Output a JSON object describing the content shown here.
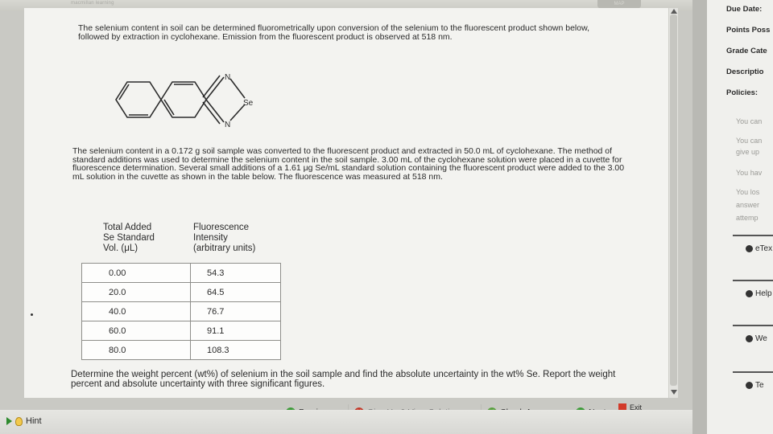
{
  "header": {
    "brand": "macmillan learning",
    "map_label": "MAP"
  },
  "question": {
    "intro": "The selenium content in soil can be determined fluorometrically upon conversion of the selenium to the fluorescent product shown below, followed by extraction in cyclohexane. Emission from the fluorescent product is observed at 518 nm.",
    "molecule_labels": {
      "n_top": "N",
      "se": "Se",
      "n_bottom": "N"
    },
    "body": "The selenium content in a 0.172 g soil sample was converted to the fluorescent product and extracted in 50.0 mL of cyclohexane. The method of standard additions was used to determine the selenium content in the soil sample. 3.00 mL of the cyclohexane solution were placed in a cuvette for fluorescence determination. Several small additions of a 1.61 μg Se/mL standard solution containing the fluorescent product were added to the 3.00 mL solution in the cuvette as shown in the table below. The fluorescence was measured at 518 nm.",
    "table": {
      "col1_header": [
        "Total Added",
        "Se Standard",
        "Vol. (μL)"
      ],
      "col2_header": [
        "Fluorescence",
        "Intensity",
        "(arbitrary units)"
      ],
      "rows": [
        [
          "0.00",
          "54.3"
        ],
        [
          "20.0",
          "64.5"
        ],
        [
          "40.0",
          "76.7"
        ],
        [
          "60.0",
          "91.1"
        ],
        [
          "80.0",
          "108.3"
        ]
      ]
    },
    "prompt": "Determine the weight percent (wt%) of selenium in the soil sample and find the absolute uncertainty in the wt% Se. Report the weight percent and absolute uncertainty with three significant figures."
  },
  "nav": {
    "previous": "Previous",
    "give_up": "Give Up & View Solution",
    "check": "Check Answer",
    "next": "Next",
    "exit": "Exit"
  },
  "hint": {
    "label": "Hint"
  },
  "right_panel": {
    "due_date": "Due Date:",
    "points": "Points Poss",
    "grade": "Grade Cate",
    "description": "Descriptio",
    "policies": "Policies:",
    "notes": [
      "You can",
      "You can",
      "give up",
      "You hav",
      "You los",
      "answer",
      "attemp"
    ],
    "links": [
      "eTex",
      "Help",
      "We",
      "Te"
    ]
  },
  "colors": {
    "accent_green": "#3e9b3a",
    "accent_red": "#c33a2a"
  }
}
